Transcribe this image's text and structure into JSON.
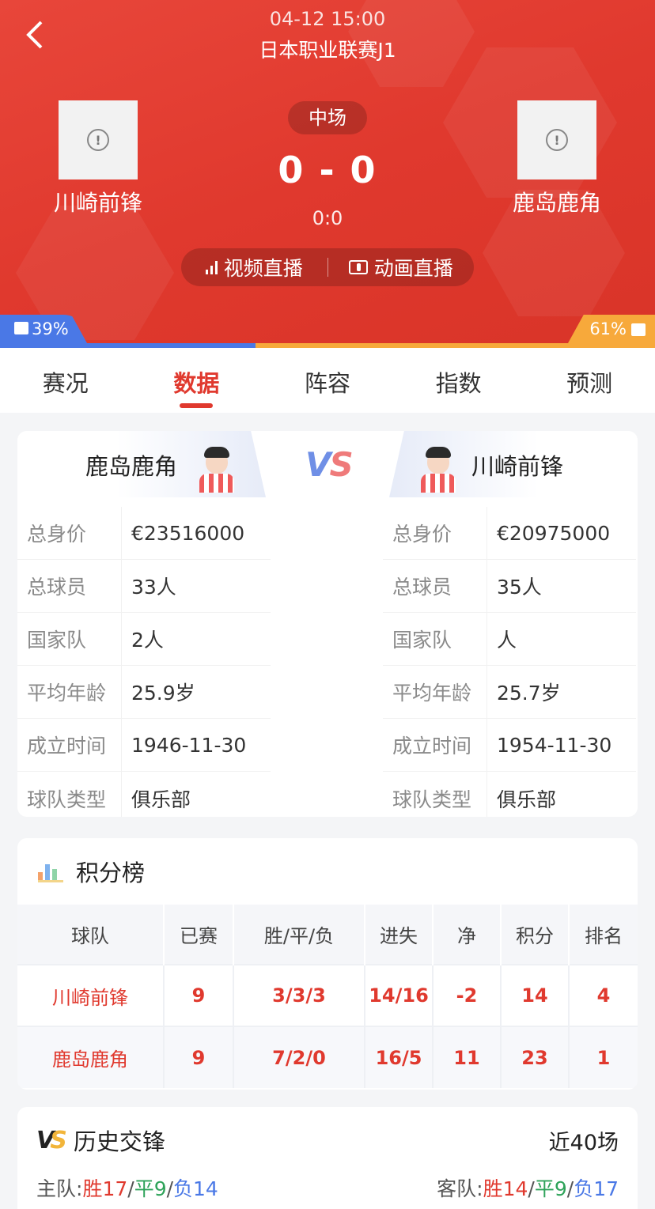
{
  "header": {
    "date_time": "04-12 15:00",
    "league": "日本职业联赛J1",
    "status": "中场",
    "score": "0 - 0",
    "half_score": "0:0",
    "home_team": "川崎前锋",
    "away_team": "鹿岛鹿角",
    "live_video": "视频直播",
    "live_animation": "动画直播"
  },
  "votes": {
    "home_pct": "39%",
    "away_pct": "61%",
    "home_fraction": 0.39
  },
  "tabs": [
    "赛况",
    "数据",
    "阵容",
    "指数",
    "预测"
  ],
  "active_tab": "数据",
  "compare": {
    "vs_label_v": "V",
    "vs_label_s": "S",
    "left_team": "鹿岛鹿角",
    "right_team": "川崎前锋",
    "left": [
      {
        "label": "总身价",
        "value": "€23516000"
      },
      {
        "label": "总球员",
        "value": "33人"
      },
      {
        "label": "国家队",
        "value": "2人"
      },
      {
        "label": "平均年龄",
        "value": "25.9岁"
      },
      {
        "label": "成立时间",
        "value": "1946-11-30"
      },
      {
        "label": "球队类型",
        "value": "俱乐部"
      }
    ],
    "right": [
      {
        "label": "总身价",
        "value": "€20975000"
      },
      {
        "label": "总球员",
        "value": "35人"
      },
      {
        "label": "国家队",
        "value": "人"
      },
      {
        "label": "平均年龄",
        "value": "25.7岁"
      },
      {
        "label": "成立时间",
        "value": "1954-11-30"
      },
      {
        "label": "球队类型",
        "value": "俱乐部"
      }
    ]
  },
  "standings": {
    "title": "积分榜",
    "headers": [
      "球队",
      "已赛",
      "胜/平/负",
      "进失",
      "净",
      "积分",
      "排名"
    ],
    "rows": [
      [
        "川崎前锋",
        "9",
        "3/3/3",
        "14/16",
        "-2",
        "14",
        "4"
      ],
      [
        "鹿岛鹿角",
        "9",
        "7/2/0",
        "16/5",
        "11",
        "23",
        "1"
      ]
    ]
  },
  "h2h": {
    "title": "历史交锋",
    "count": "近40场",
    "home_label": "主队:",
    "home_w": "胜17",
    "home_d": "平9",
    "home_l": "负14",
    "away_label": "客队:",
    "away_w": "胜14",
    "away_d": "平9",
    "away_l": "负17",
    "sep": "/"
  },
  "colors": {
    "brand_red": "#e0392e",
    "home_blue": "#4a78e6",
    "away_orange": "#f7a93b",
    "draw_green": "#2fa35a"
  }
}
